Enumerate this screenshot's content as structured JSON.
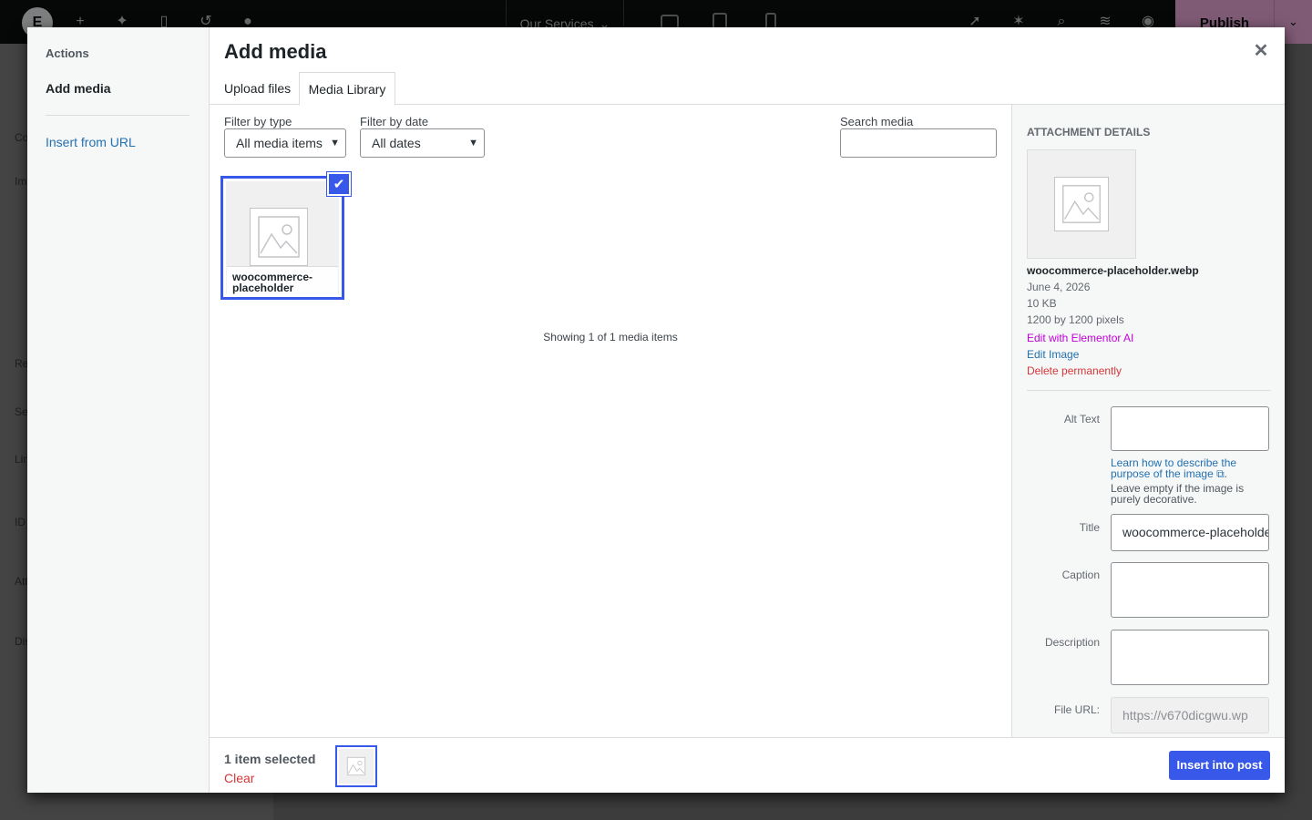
{
  "editor": {
    "logo_label": "E",
    "page_title": "Our Services",
    "publish_label": "Publish",
    "panel_fragments": [
      "Co",
      "Im",
      "Re",
      "Se",
      "Lin",
      "ID",
      "Att",
      "Dis"
    ]
  },
  "modal": {
    "menu": {
      "heading": "Actions",
      "active_item": "Add media",
      "insert_from_url": "Insert from URL"
    },
    "title": "Add media",
    "close_icon": "close-icon",
    "tabs": [
      {
        "label": "Upload files",
        "active": false
      },
      {
        "label": "Media Library",
        "active": true
      }
    ],
    "filters": {
      "type_label": "Filter by type",
      "type_value": "All media items",
      "date_label": "Filter by date",
      "date_value": "All dates",
      "search_label": "Search media",
      "search_value": ""
    },
    "attachments": [
      {
        "name": "woocommerce-placeholder",
        "selected": true
      }
    ],
    "count_text": "Showing 1 of 1 media items",
    "details": {
      "heading": "Attachment Details",
      "filename": "woocommerce-placeholder.webp",
      "date": "June 4, 2026",
      "size": "10 KB",
      "dimensions": "1200 by 1200 pixels",
      "edit_ai": "Edit with Elementor AI",
      "edit_image": "Edit Image",
      "delete": "Delete permanently",
      "alt_label": "Alt Text",
      "alt_value": "",
      "alt_help_link": "Learn how to describe the purpose of the image",
      "alt_help_suffix": ".",
      "alt_note": "Leave empty if the image is purely decorative.",
      "title_label": "Title",
      "title_value": "woocommerce-placeholder",
      "caption_label": "Caption",
      "caption_value": "",
      "description_label": "Description",
      "description_value": "",
      "url_label": "File URL:",
      "url_value": "https://v670dicgwu.wp"
    },
    "footer": {
      "selected_count": "1 item selected",
      "clear_label": "Clear",
      "insert_label": "Insert into post"
    }
  },
  "colors": {
    "accent": "#3858e9",
    "link": "#2271b1",
    "danger": "#d63638",
    "ai": "#c100d8",
    "publish": "#e7a6d8"
  }
}
